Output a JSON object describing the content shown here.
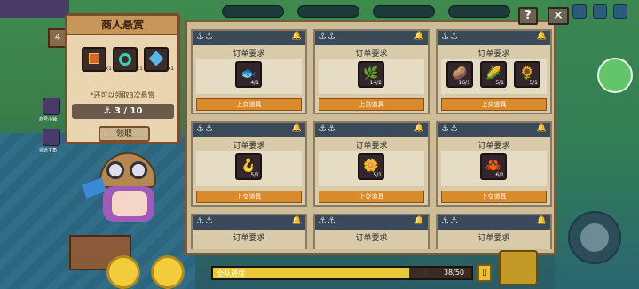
{
  "bounty": {
    "title": "商人悬赏",
    "slots": [
      {
        "icon": "treasure-box-icon",
        "qty": "x1"
      },
      {
        "icon": "teal-ring-icon",
        "qty": "x1"
      },
      {
        "icon": "blue-gem-icon",
        "qty": "x1"
      }
    ],
    "note": "*还可以领取3次悬赏",
    "count": "3 / 10",
    "claim_label": "领取"
  },
  "board": {
    "cards": [
      {
        "title": "订单要求",
        "items": [
          {
            "icon": "fish-icon",
            "glyph": "🐟",
            "qty": "4/1"
          }
        ],
        "submit": "上交道具"
      },
      {
        "title": "订单要求",
        "items": [
          {
            "icon": "green-plant-icon",
            "glyph": "🌿",
            "qty": "14/2"
          }
        ],
        "submit": "上交道具"
      },
      {
        "title": "订单要求",
        "items": [
          {
            "icon": "potato-icon",
            "glyph": "🥔",
            "qty": "16/1"
          },
          {
            "icon": "corn-icon",
            "glyph": "🌽",
            "qty": "5/1"
          },
          {
            "icon": "sunflower-icon",
            "glyph": "🌻",
            "qty": "5/1"
          }
        ],
        "submit": "上交道具"
      },
      {
        "title": "订单要求",
        "items": [
          {
            "icon": "fish-hook-icon",
            "glyph": "🪝",
            "qty": "5/1"
          }
        ],
        "submit": "上交道具"
      },
      {
        "title": "订单要求",
        "items": [
          {
            "icon": "flower-icon",
            "glyph": "🌼",
            "qty": "5/1"
          }
        ],
        "submit": "上交道具"
      },
      {
        "title": "订单要求",
        "items": [
          {
            "icon": "crab-icon",
            "glyph": "🦀",
            "qty": "6/1"
          }
        ],
        "submit": "上交道具"
      },
      {
        "title": "订单要求",
        "items": [],
        "submit": ""
      },
      {
        "title": "订单要求",
        "items": [],
        "submit": ""
      },
      {
        "title": "订单要求",
        "items": [],
        "submit": ""
      }
    ]
  },
  "help_label": "?",
  "close_label": "✕",
  "progress": {
    "label": "全队进度",
    "value": "38/50",
    "fraction": 0.76
  },
  "left_badge": "4",
  "side_labels": [
    "商号小铺",
    "遥远主角"
  ],
  "colors": {
    "card_header": "#3b4a5a",
    "submit_button": "#d98a2c",
    "panel_border": "#7b5a38",
    "progress_fill": "#e8c93a"
  }
}
